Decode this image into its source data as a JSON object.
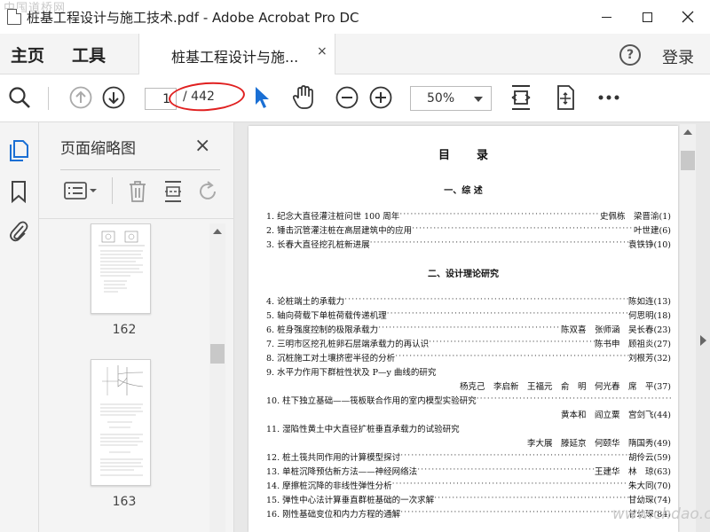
{
  "window": {
    "title": "桩基工程设计与施工技术.pdf - Adobe Acrobat Pro DC",
    "watermark_top": "中国道桥网",
    "watermark_bottom": "www.chdao.com"
  },
  "nav": {
    "home": "主页",
    "tools": "工具",
    "doc_tab": "桩基工程设计与施...",
    "doc_tab_close": "×",
    "help": "?",
    "signin": "登录"
  },
  "toolbar": {
    "page_current": "1",
    "page_total": "/ 442",
    "zoom": "50%",
    "highlight_color": "#e02020",
    "accent_color": "#1a6fd4"
  },
  "thumbnails": {
    "title": "页面缩略图",
    "close": "×",
    "pages": [
      {
        "label": "162"
      },
      {
        "label": "163"
      }
    ]
  },
  "document": {
    "toc_title": "目录",
    "sections": [
      {
        "heading": "一、综 述",
        "entries": [
          {
            "title": "1. 纪念大直径灌注桩问世 100 周年",
            "authors": "史佩栋　梁晋渝(1)"
          },
          {
            "title": "2. 锤击沉管灌注桩在高层建筑中的应用",
            "authors": "叶世建(6)"
          },
          {
            "title": "3. 长春大直径挖孔桩新进展",
            "authors": "袁铁铮(10)"
          }
        ]
      },
      {
        "heading": "二、设计理论研究",
        "entries": [
          {
            "title": "4. 论桩端土的承载力",
            "authors": "陈如连(13)"
          },
          {
            "title": "5. 轴向荷载下单桩荷载传递机理",
            "authors": "何思明(18)"
          },
          {
            "title": "6. 桩身强度控制的极限承载力",
            "authors": "陈双喜　张师涵　吴长春(23)"
          },
          {
            "title": "7. 三明市区挖孔桩卵石层端承载力的再认识",
            "authors": "陈书申　顾祖炎(27)"
          },
          {
            "title": "8. 沉桩施工对土壤挤密半径的分析",
            "authors": "刘根芳(32)"
          },
          {
            "title": "9. 水平力作用下群桩性状及 P—y 曲线的研究",
            "authors": "",
            "sub": "杨克己　李启新　王福元　俞　明　何光春　席　平(37)"
          },
          {
            "title": "10. 柱下独立基础——筏板联合作用的室内模型实验研究",
            "authors": "",
            "sub": "黄本和　阎立粟　宫剑飞(44)"
          },
          {
            "title": "11. 湿陷性黄土中大直径扩桩垂直承载力的试验研究",
            "authors": "",
            "sub": "李大展　滕延京　何颐华　隋国秀(49)"
          },
          {
            "title": "12. 桩土筏共同作用的计算模型探讨",
            "authors": "胡伶云(59)"
          },
          {
            "title": "13. 单桩沉降预估新方法——神经网络法",
            "authors": "王建华　林　琼(63)"
          },
          {
            "title": "14. 摩擦桩沉降的非线性弹性分析",
            "authors": "朱大同(70)"
          },
          {
            "title": "15. 弹性中心法计算垂直群桩基础的一次求解",
            "authors": "甘幼琛(74)"
          },
          {
            "title": "16. 刚性基础变位和内力方程的通解",
            "authors": "甘幼琛(84)"
          }
        ]
      }
    ]
  }
}
